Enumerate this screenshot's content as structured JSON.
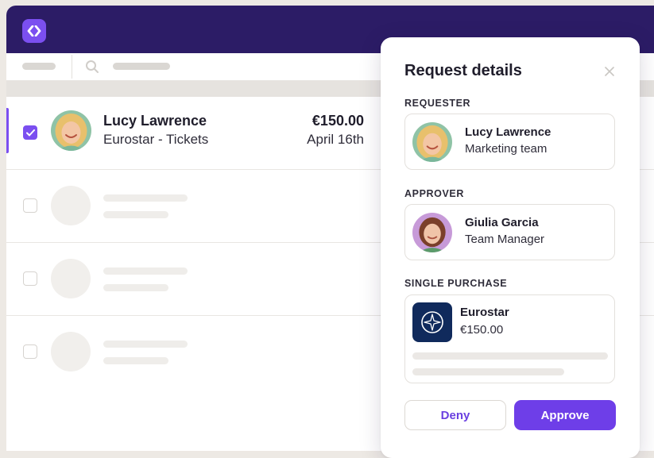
{
  "list": {
    "active_row": {
      "name": "Lucy Lawrence",
      "description": "Eurostar - Tickets",
      "amount": "€150.00",
      "date": "April 16th",
      "checked": true
    }
  },
  "panel": {
    "title": "Request details",
    "requester": {
      "label": "REQUESTER",
      "name": "Lucy Lawrence",
      "team": "Marketing team"
    },
    "approver": {
      "label": "APPROVER",
      "name": "Giulia Garcia",
      "role": "Team Manager"
    },
    "purchase": {
      "label": "SINGLE PURCHASE",
      "merchant": "Eurostar",
      "amount": "€150.00"
    },
    "deny_label": "Deny",
    "approve_label": "Approve"
  },
  "colors": {
    "topbar": "#2c1c66",
    "accent": "#7b4ff0",
    "approve": "#6e3ee8",
    "merchant_logo": "#102a5c"
  }
}
